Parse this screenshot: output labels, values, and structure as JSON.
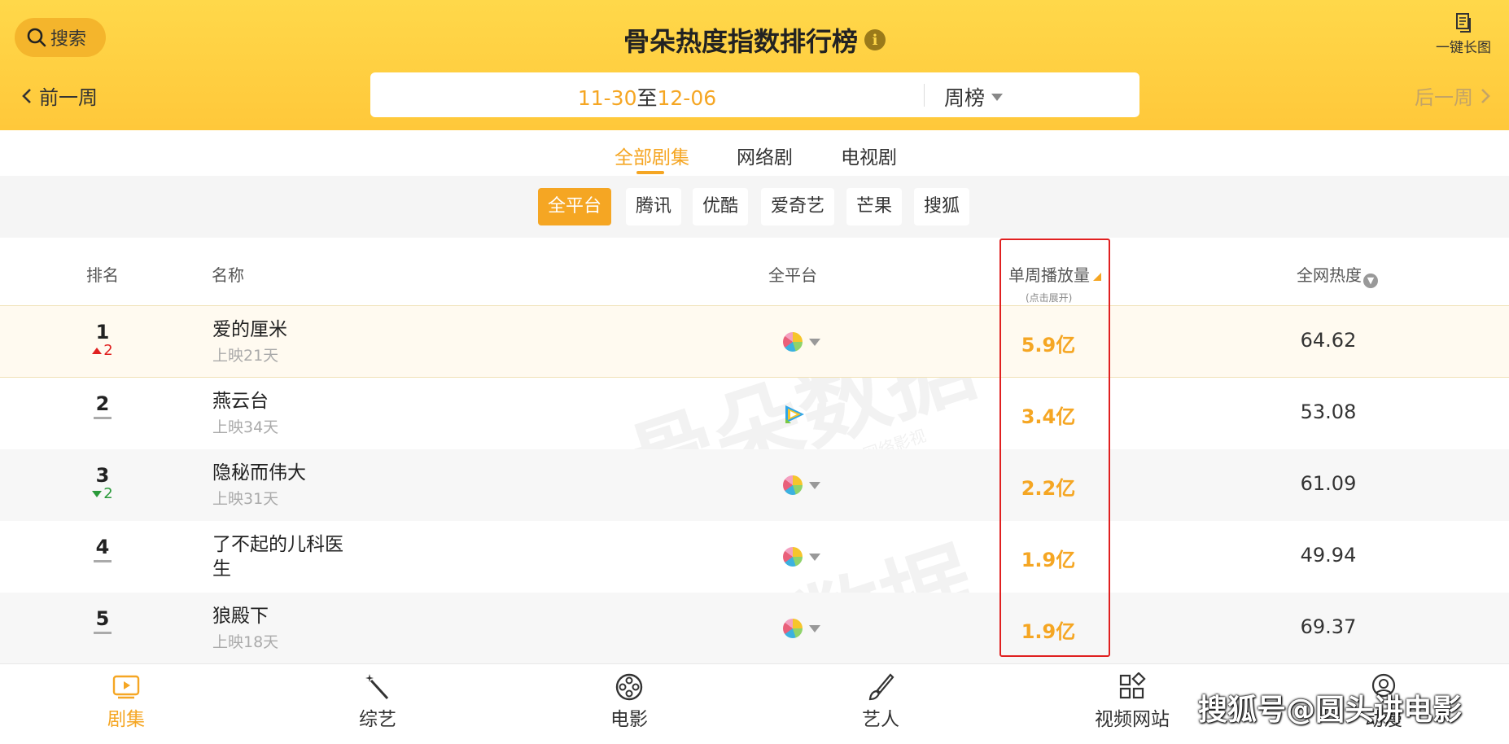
{
  "header": {
    "search_label": "搜索",
    "title": "骨朵热度指数排行榜",
    "info_glyph": "i",
    "long_image_label": "一键长图",
    "prev_week": "前一周",
    "next_week": "后一周",
    "date_start": "11-30",
    "date_sep": "至",
    "date_end": "12-06",
    "period": "周榜"
  },
  "category_tabs": [
    {
      "label": "全部剧集",
      "active": true
    },
    {
      "label": "网络剧",
      "active": false
    },
    {
      "label": "电视剧",
      "active": false
    }
  ],
  "platforms": [
    {
      "label": "全平台",
      "active": true
    },
    {
      "label": "腾讯",
      "active": false
    },
    {
      "label": "优酷",
      "active": false
    },
    {
      "label": "爱奇艺",
      "active": false
    },
    {
      "label": "芒果",
      "active": false
    },
    {
      "label": "搜狐",
      "active": false
    }
  ],
  "table": {
    "headers": {
      "rank": "排名",
      "name": "名称",
      "platform": "全平台",
      "plays": "单周播放量",
      "plays_hint": "(点击展开)",
      "heat": "全网热度"
    },
    "rows": [
      {
        "rank": "1",
        "change": "2",
        "change_dir": "up",
        "name": "爱的厘米",
        "days": "上映21天",
        "platform_icon": "multi-platform-pie-icon",
        "plays": "5.9亿",
        "heat": "64.62"
      },
      {
        "rank": "2",
        "change": "",
        "change_dir": "none",
        "name": "燕云台",
        "days": "上映34天",
        "platform_icon": "tencent-video-icon",
        "plays": "3.4亿",
        "heat": "53.08"
      },
      {
        "rank": "3",
        "change": "2",
        "change_dir": "down",
        "name": "隐秘而伟大",
        "days": "上映31天",
        "platform_icon": "multi-platform-pie-icon",
        "plays": "2.2亿",
        "heat": "61.09"
      },
      {
        "rank": "4",
        "change": "",
        "change_dir": "none",
        "name": "了不起的儿科医生",
        "days": "",
        "platform_icon": "multi-platform-pie-icon",
        "plays": "1.9亿",
        "heat": "49.94"
      },
      {
        "rank": "5",
        "change": "",
        "change_dir": "none",
        "name": "狼殿下",
        "days": "上映18天",
        "platform_icon": "multi-platform-pie-icon",
        "plays": "1.9亿",
        "heat": "69.37"
      }
    ]
  },
  "watermark": {
    "text": "骨朵数据",
    "sub": "@骨朵网络影视"
  },
  "bottom_nav": [
    {
      "label": "剧集",
      "icon": "play-icon",
      "active": true
    },
    {
      "label": "综艺",
      "icon": "magic-wand-icon",
      "active": false
    },
    {
      "label": "电影",
      "icon": "film-reel-icon",
      "active": false
    },
    {
      "label": "艺人",
      "icon": "brush-icon",
      "active": false
    },
    {
      "label": "视频网站",
      "icon": "apps-icon",
      "active": false
    },
    {
      "label": "动漫",
      "icon": "character-icon",
      "active": false
    }
  ],
  "overlay_text": "搜狐号@圆头讲电影",
  "colors": {
    "accent": "#f5a623",
    "header_bg": "#ffd84a",
    "up": "#e02020",
    "down": "#2a9a3a",
    "highlight_border": "#e02020"
  }
}
